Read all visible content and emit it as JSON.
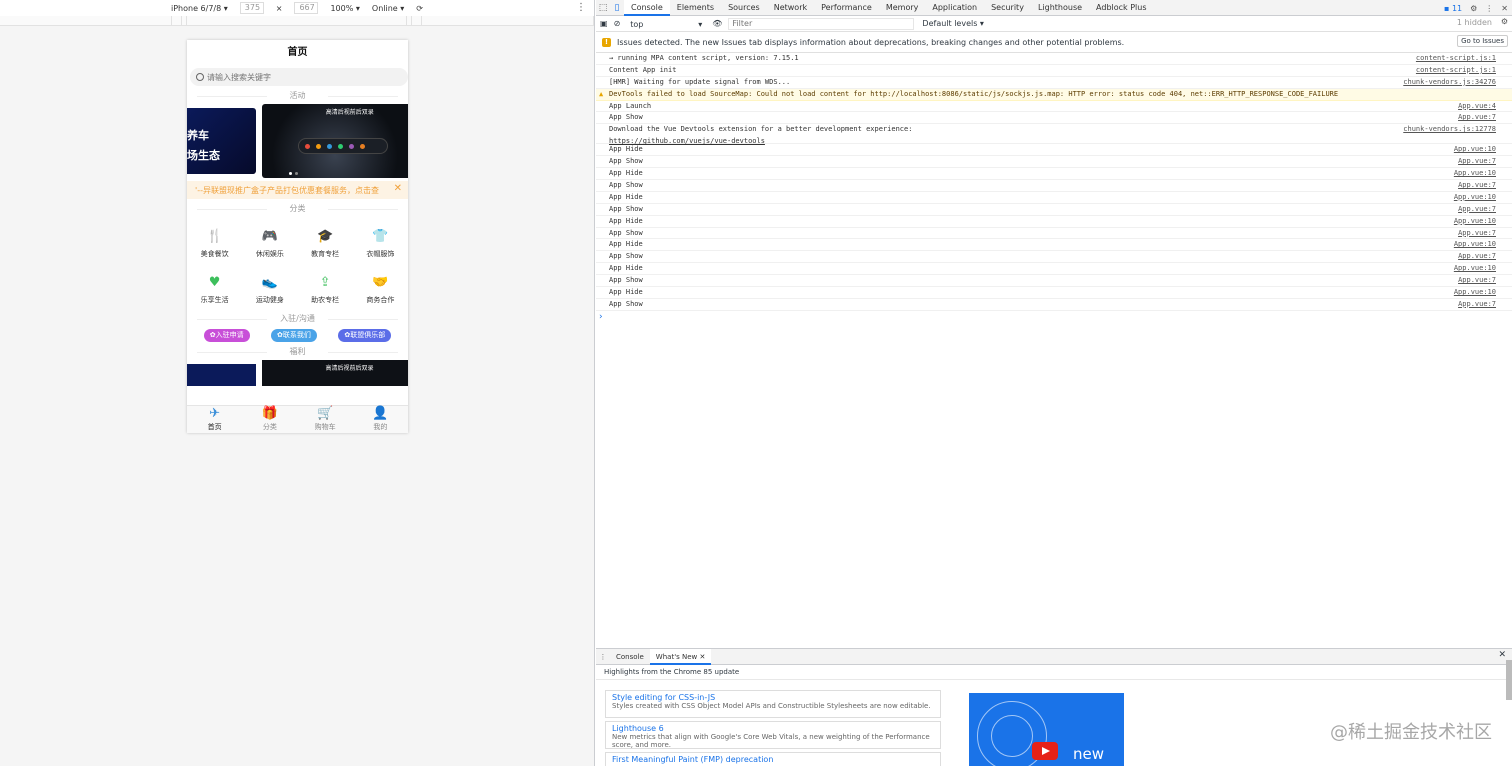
{
  "emulator": {
    "device": "iPhone 6/7/8 ▾",
    "width": "375",
    "times": "×",
    "height": "667",
    "zoom": "100% ▾",
    "network": "Online ▾"
  },
  "phone": {
    "title": "首页",
    "search_placeholder": "请输入搜索关键字",
    "section_activity": "活动",
    "banner_a_text": "养车\n场生态",
    "banner_b_caption": "高清后视前后双录",
    "notice": "'--异联盟现推广盒子产品打包优惠套餐服务，点击查",
    "notice_close": "✕",
    "section_category": "分类",
    "categories": [
      {
        "label": "美食餐饮",
        "icon": "utensils-icon",
        "glyph": "🍴",
        "color": "#e0a82e"
      },
      {
        "label": "休闲娱乐",
        "icon": "gamepad-icon",
        "glyph": "🎮",
        "color": "#e0a82e"
      },
      {
        "label": "教育专栏",
        "icon": "graduation-cap-icon",
        "glyph": "🎓",
        "color": "#e0a82e"
      },
      {
        "label": "衣帽服饰",
        "icon": "shirt-icon",
        "glyph": "👕",
        "color": "#555555"
      },
      {
        "label": "乐享生活",
        "icon": "hand-heart-icon",
        "glyph": "♥",
        "color": "#3dbf5c"
      },
      {
        "label": "运动健身",
        "icon": "sneaker-icon",
        "glyph": "👟",
        "color": "#3dbf5c"
      },
      {
        "label": "助农专栏",
        "icon": "upload-tray-icon",
        "glyph": "⇪",
        "color": "#3dbf5c"
      },
      {
        "label": "商务合作",
        "icon": "handshake-icon",
        "glyph": "🤝",
        "color": "#1a3a7a"
      }
    ],
    "section_join": "入驻/沟通",
    "buttons": [
      {
        "label": "✿入驻申请",
        "color": "#c84fd8"
      },
      {
        "label": "✿联系我们",
        "color": "#4aa3e8"
      },
      {
        "label": "✿联盟俱乐部",
        "color": "#5b6de8"
      }
    ],
    "section_welfare": "福利",
    "banner2_caption": "高清后视前后双录",
    "tabs": [
      {
        "label": "首页",
        "icon": "paper-plane-icon",
        "glyph": "✈",
        "active": true
      },
      {
        "label": "分类",
        "icon": "gift-icon",
        "glyph": "🎁",
        "active": false
      },
      {
        "label": "购物车",
        "icon": "cart-icon",
        "glyph": "🛒",
        "active": false
      },
      {
        "label": "我的",
        "icon": "user-icon",
        "glyph": "👤",
        "active": false
      }
    ]
  },
  "devtools": {
    "tabs": [
      "Console",
      "Elements",
      "Sources",
      "Network",
      "Performance",
      "Memory",
      "Application",
      "Security",
      "Lighthouse",
      "Adblock Plus"
    ],
    "active_tab": "Console",
    "issue_count": "11",
    "context": "top",
    "filter_placeholder": "Filter",
    "levels": "Default levels ▾",
    "hidden": "1 hidden",
    "issues_text": "Issues detected. The new Issues tab displays information about deprecations, breaking changes and other potential problems.",
    "go_to_issues": "Go to Issues",
    "logs": [
      {
        "text": "→ running MPA content script, version: 7.15.1",
        "src": "content-script.js:1"
      },
      {
        "text": "Content App init",
        "src": "content-script.js:1"
      },
      {
        "text": "[HMR] Waiting for update signal from WDS...",
        "src": "chunk-vendors.js:34276"
      },
      {
        "text": "DevTools failed to load SourceMap: Could not load content for http://localhost:8086/static/js/sockjs.js.map: HTTP error: status code 404, net::ERR_HTTP_RESPONSE_CODE_FAILURE",
        "src": "",
        "warn": true
      },
      {
        "text": "App Launch",
        "src": "App.vue:4"
      },
      {
        "text": "App Show",
        "src": "App.vue:7"
      },
      {
        "text": "Download the Vue Devtools extension for a better development experience:",
        "text2": "https://github.com/vuejs/vue-devtools",
        "src": "chunk-vendors.js:12778"
      },
      {
        "text": "App Hide",
        "src": "App.vue:10"
      },
      {
        "text": "App Show",
        "src": "App.vue:7"
      },
      {
        "text": "App Hide",
        "src": "App.vue:10"
      },
      {
        "text": "App Show",
        "src": "App.vue:7"
      },
      {
        "text": "App Hide",
        "src": "App.vue:10"
      },
      {
        "text": "App Show",
        "src": "App.vue:7"
      },
      {
        "text": "App Hide",
        "src": "App.vue:10"
      },
      {
        "text": "App Show",
        "src": "App.vue:7"
      },
      {
        "text": "App Hide",
        "src": "App.vue:10"
      },
      {
        "text": "App Show",
        "src": "App.vue:7"
      },
      {
        "text": "App Hide",
        "src": "App.vue:10"
      },
      {
        "text": "App Show",
        "src": "App.vue:7"
      },
      {
        "text": "App Hide",
        "src": "App.vue:10"
      },
      {
        "text": "App Show",
        "src": "App.vue:7"
      }
    ],
    "prompt": "›",
    "drawer": {
      "tabs": [
        "Console",
        "What's New"
      ],
      "active": "What's New",
      "close_tab": "✕",
      "close": "✕",
      "highlights": "Highlights from the Chrome 85 update",
      "cards": [
        {
          "title": "Style editing for CSS-in-JS",
          "desc": "Styles created with CSS Object Model APIs and Constructible Stylesheets are now editable."
        },
        {
          "title": "Lighthouse 6",
          "desc": "New metrics that align with Google's Core Web Vitals, a new weighting of the Performance score, and more."
        },
        {
          "title": "First Meaningful Paint (FMP) deprecation",
          "desc": ""
        }
      ],
      "video_text": "new"
    }
  },
  "watermark": "@稀土掘金技术社区"
}
